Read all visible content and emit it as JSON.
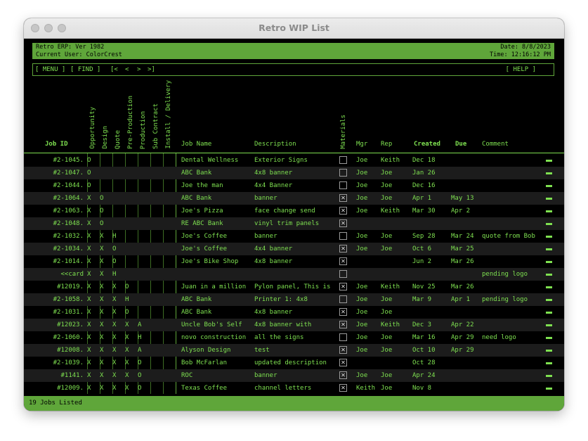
{
  "window": {
    "title": "Retro WIP List"
  },
  "header": {
    "version": "Retro ERP: Ver 1982",
    "user": "Current User: ColorCrest",
    "date": "Date: 8/8/2023",
    "time": "Time:   12:16:12 PM"
  },
  "commands": {
    "menu": "[ MENU ]",
    "find": "[ FIND ]",
    "first": "[<",
    "prev": "<",
    "next": ">",
    "last": ">]",
    "help": "[ HELP ]"
  },
  "stages": [
    "Opportunity",
    "Design",
    "Quote",
    "Pre-Production",
    "Production",
    "Sub Contract",
    "Install / Delivery"
  ],
  "columns": {
    "job_id": "Job ID",
    "materials": "Materials",
    "job_name": "Job Name",
    "description": "Description",
    "mgr": "Mgr",
    "rep": "Rep",
    "created": "Created",
    "due": "Due",
    "comment": "Comment"
  },
  "jobs": [
    {
      "id": "#2-1045.",
      "s": [
        "O",
        "",
        "",
        "",
        "",
        "",
        ""
      ],
      "name": "Dental Wellness",
      "desc": "Exterior Signs",
      "mat": false,
      "mgr": "Joe",
      "rep": "Keith",
      "created": "Dec 18",
      "due": "",
      "comment": ""
    },
    {
      "id": "#2-1047.",
      "s": [
        "O",
        "",
        "",
        "",
        "",
        "",
        ""
      ],
      "name": "ABC Bank",
      "desc": "4x8 banner",
      "mat": false,
      "mgr": "Joe",
      "rep": "Joe",
      "created": "Jan 26",
      "due": "",
      "comment": ""
    },
    {
      "id": "#2-1044.",
      "s": [
        "O",
        "",
        "",
        "",
        "",
        "",
        ""
      ],
      "name": "Joe the man",
      "desc": "4x4 Banner",
      "mat": false,
      "mgr": "Joe",
      "rep": "Joe",
      "created": "Dec 16",
      "due": "",
      "comment": ""
    },
    {
      "id": "#2-1064.",
      "s": [
        "X",
        "O",
        "",
        "",
        "",
        "",
        ""
      ],
      "name": "ABC Bank",
      "desc": "banner",
      "mat": true,
      "mgr": "Joe",
      "rep": "Joe",
      "created": "Apr 1",
      "due": "May 13",
      "comment": ""
    },
    {
      "id": "#2-1063.",
      "s": [
        "X",
        "O",
        "",
        "",
        "",
        "",
        ""
      ],
      "name": "Joe's Pizza",
      "desc": "face change send",
      "mat": true,
      "mgr": "Joe",
      "rep": "Keith",
      "created": "Mar 30",
      "due": "Apr 2",
      "comment": ""
    },
    {
      "id": "#2-1048.",
      "s": [
        "X",
        "O",
        "",
        "",
        "",
        "",
        ""
      ],
      "name": "RE ABC Bank",
      "desc": "vinyl trim panels",
      "mat": true,
      "mgr": "",
      "rep": "",
      "created": "",
      "due": "",
      "comment": ""
    },
    {
      "id": "#2-1032.",
      "s": [
        "X",
        "X",
        "H",
        "",
        "",
        "",
        ""
      ],
      "name": "Joe's Coffee",
      "desc": "banner",
      "mat": false,
      "mgr": "Joe",
      "rep": "Joe",
      "created": "Sep 28",
      "due": "Mar 24",
      "comment": "quote from Bob"
    },
    {
      "id": "#2-1034.",
      "s": [
        "X",
        "X",
        "O",
        "",
        "",
        "",
        ""
      ],
      "name": "Joe's Coffee",
      "desc": "4x4 banner",
      "mat": true,
      "mgr": "Joe",
      "rep": "Joe",
      "created": "Oct 6",
      "due": "Mar 25",
      "comment": ""
    },
    {
      "id": "#2-1014.",
      "s": [
        "X",
        "X",
        "O",
        "",
        "",
        "",
        ""
      ],
      "name": "Joe's Bike Shop",
      "desc": "4x8 banner",
      "mat": true,
      "mgr": "",
      "rep": "",
      "created": "Jun 2",
      "due": "Mar 26",
      "comment": ""
    },
    {
      "id": "<<card",
      "s": [
        "X",
        "X",
        "H",
        "",
        "",
        "",
        ""
      ],
      "name": "",
      "desc": "",
      "mat": false,
      "mgr": "",
      "rep": "",
      "created": "",
      "due": "",
      "comment": "pending logo"
    },
    {
      "id": "#12019.",
      "s": [
        "X",
        "X",
        "X",
        "O",
        "",
        "",
        ""
      ],
      "name": "Juan in a million",
      "desc": "Pylon panel, This is",
      "mat": true,
      "mgr": "Joe",
      "rep": "Keith",
      "created": "Nov 25",
      "due": "Mar 26",
      "comment": ""
    },
    {
      "id": "#2-1058.",
      "s": [
        "X",
        "X",
        "X",
        "H",
        "",
        "",
        ""
      ],
      "name": "ABC Bank",
      "desc": "Printer 1: 4x8",
      "mat": false,
      "mgr": "Joe",
      "rep": "Joe",
      "created": "Mar 9",
      "due": "Apr 1",
      "comment": "pending logo"
    },
    {
      "id": "#2-1031.",
      "s": [
        "X",
        "X",
        "X",
        "O",
        "",
        "",
        ""
      ],
      "name": "ABC Bank",
      "desc": "4x8 banner",
      "mat": true,
      "mgr": "Joe",
      "rep": "Joe",
      "created": "",
      "due": "",
      "comment": ""
    },
    {
      "id": "#12023.",
      "s": [
        "X",
        "X",
        "X",
        "X",
        "A",
        "",
        ""
      ],
      "name": "Uncle Bob's Self",
      "desc": "4x8 banner with",
      "mat": true,
      "mgr": "Joe",
      "rep": "Keith",
      "created": "Dec 3",
      "due": "Apr 22",
      "comment": ""
    },
    {
      "id": "#2-1060.",
      "s": [
        "X",
        "X",
        "X",
        "X",
        "H",
        "",
        ""
      ],
      "name": "novo construction",
      "desc": "all the signs",
      "mat": false,
      "mgr": "Joe",
      "rep": "Joe",
      "created": "Mar 16",
      "due": "Apr 29",
      "comment": "need logo"
    },
    {
      "id": "#12008.",
      "s": [
        "X",
        "X",
        "X",
        "X",
        "A",
        "",
        ""
      ],
      "name": "Alyson Design",
      "desc": "test",
      "mat": true,
      "mgr": "Joe",
      "rep": "Joe",
      "created": "Oct 10",
      "due": "Apr 29",
      "comment": ""
    },
    {
      "id": "#2-1039.",
      "s": [
        "X",
        "X",
        "X",
        "X",
        "O",
        "",
        ""
      ],
      "name": "Bob McFarlan",
      "desc": "updated description",
      "mat": true,
      "mgr": "",
      "rep": "",
      "created": "Oct 28",
      "due": "",
      "comment": ""
    },
    {
      "id": "#1141.",
      "s": [
        "X",
        "X",
        "X",
        "X",
        "O",
        "",
        ""
      ],
      "name": "ROC",
      "desc": "banner",
      "mat": true,
      "mgr": "Joe",
      "rep": "Joe",
      "created": "Apr 24",
      "due": "",
      "comment": ""
    },
    {
      "id": "#12009.",
      "s": [
        "X",
        "X",
        "X",
        "X",
        "O",
        "",
        ""
      ],
      "name": "Texas Coffee",
      "desc": "channel letters",
      "mat": true,
      "mgr": "Keith",
      "rep": "Joe",
      "created": "Nov 8",
      "due": "",
      "comment": ""
    }
  ],
  "status": {
    "text": "19 Jobs Listed"
  },
  "icons": {
    "traffic_lights": "window-control-icon",
    "row_action": "minus-icon",
    "checkbox_checked": "x-mark"
  },
  "colors": {
    "terminal_green": "#7ee050",
    "header_bar": "#5fa63a",
    "background": "#000000",
    "row_alt": "#1c1c1c"
  }
}
